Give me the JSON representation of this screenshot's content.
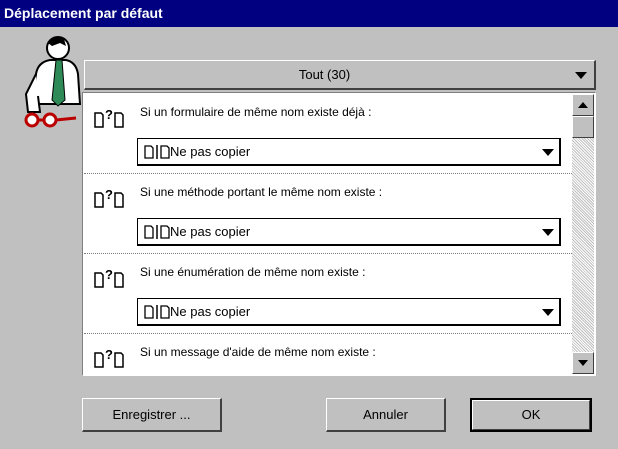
{
  "window": {
    "title": "Déplacement par défaut"
  },
  "filter": {
    "selected": "Tout (30)"
  },
  "rows": [
    {
      "question": "Si un formulaire de même nom existe déjà :",
      "value": "Ne pas copier"
    },
    {
      "question": "Si une méthode portant le même nom existe :",
      "value": "Ne pas copier"
    },
    {
      "question": "Si une énumération de même nom existe :",
      "value": "Ne pas copier"
    },
    {
      "question": "Si un message d'aide de même nom existe :",
      "value": ""
    }
  ],
  "buttons": {
    "save": "Enregistrer ...",
    "cancel": "Annuler",
    "ok": "OK"
  },
  "icons": {
    "question": "document-question-icon",
    "docs": "documents-icon",
    "mascot": "man-with-glasses-icon"
  }
}
